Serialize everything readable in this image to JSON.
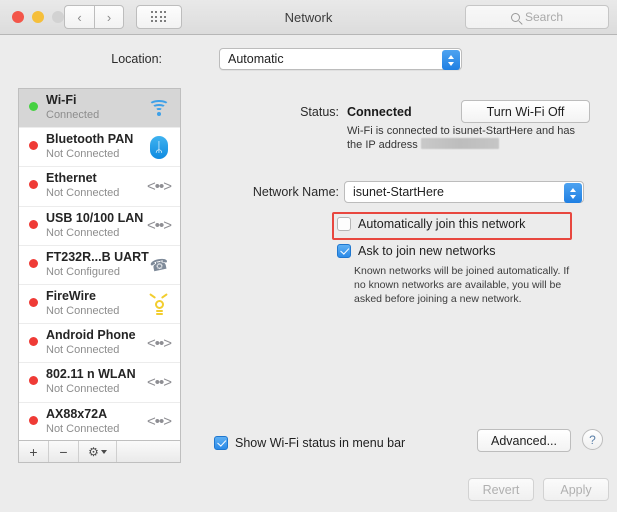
{
  "window": {
    "title": "Network",
    "traffic_lights": [
      "close",
      "minimize",
      "zoom"
    ],
    "nav_back": "‹",
    "nav_forward": "›"
  },
  "search": {
    "placeholder": "Search",
    "icon": "search-icon"
  },
  "location": {
    "label": "Location:",
    "value": "Automatic",
    "options": [
      "Automatic"
    ]
  },
  "sidebar": {
    "services": [
      {
        "name": "Wi-Fi",
        "state": "Connected",
        "dot": "green",
        "icon": "wifi-icon",
        "selected": true
      },
      {
        "name": "Bluetooth PAN",
        "state": "Not Connected",
        "dot": "red",
        "icon": "bluetooth-icon",
        "selected": false
      },
      {
        "name": "Ethernet",
        "state": "Not Connected",
        "dot": "red",
        "icon": "ethernet-icon",
        "selected": false
      },
      {
        "name": "USB 10/100 LAN",
        "state": "Not Connected",
        "dot": "red",
        "icon": "ethernet-icon",
        "selected": false
      },
      {
        "name": "FT232R...B UART",
        "state": "Not Configured",
        "dot": "red",
        "icon": "modem-icon",
        "selected": false
      },
      {
        "name": "FireWire",
        "state": "Not Connected",
        "dot": "red",
        "icon": "firewire-icon",
        "selected": false
      },
      {
        "name": "Android Phone",
        "state": "Not Connected",
        "dot": "red",
        "icon": "ethernet-icon",
        "selected": false
      },
      {
        "name": "802.11 n WLAN",
        "state": "Not Connected",
        "dot": "red",
        "icon": "ethernet-icon",
        "selected": false
      },
      {
        "name": "AX88x72A",
        "state": "Not Connected",
        "dot": "red",
        "icon": "ethernet-icon",
        "selected": false
      }
    ],
    "toolbar": {
      "add": "+",
      "remove": "−",
      "gear": "⚙"
    }
  },
  "detail": {
    "status_label": "Status:",
    "status_value": "Connected",
    "turn_wifi_button": "Turn Wi-Fi Off",
    "status_description_before": "Wi-Fi is connected to isunet-StartHere and has the IP address ",
    "status_description_after": "",
    "network_name_label": "Network Name:",
    "network_name_value": "isunet-StartHere",
    "auto_join_label": "Automatically join this network",
    "auto_join_checked": false,
    "ask_join_label": "Ask to join new networks",
    "ask_join_checked": true,
    "ask_join_description": "Known networks will be joined automatically. If no known networks are available, you will be asked before joining a new network.",
    "show_status_label": "Show Wi-Fi status in menu bar",
    "show_status_checked": true,
    "advanced_button": "Advanced...",
    "help_button": "?"
  },
  "footer": {
    "revert_button": "Revert",
    "apply_button": "Apply"
  },
  "colors": {
    "accent_blue": "#2b8ae8",
    "highlight_red": "#e8473f",
    "status_connected": "#46d142",
    "status_disconnected": "#ef3b36",
    "window_bg": "#ececec"
  }
}
